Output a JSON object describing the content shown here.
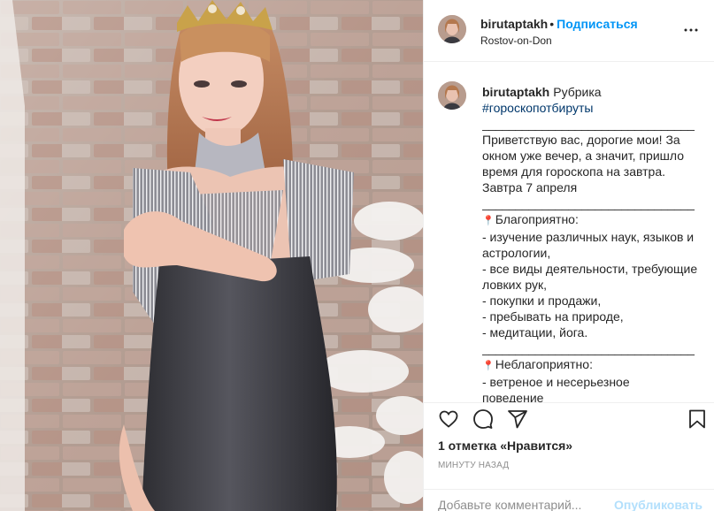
{
  "post": {
    "username": "birutaptakh",
    "separator": "•",
    "follow_label": "Подписаться",
    "location": "Rostov-on-Don"
  },
  "caption": {
    "username": "birutaptakh",
    "lead": "Рубрика",
    "hashtag": "#гороскопотбируты",
    "divider1": "________________________________",
    "greeting": [
      "Приветствую вас, дорогие мои! За",
      "окном уже вечер, а значит, пришло",
      "время для гороскопа на завтра.",
      "Завтра 7 апреля"
    ],
    "divider2": "________________________________",
    "favorable_title": "Благоприятно:",
    "favorable": [
      "- изучение различных наук, языков и",
      "астрологии,",
      "- все виды деятельности, требующие",
      "ловких рук,",
      "- покупки и продажи,",
      "- пребывать на природе,",
      "- медитации, йога."
    ],
    "divider3": "________________________________",
    "unfavorable_title": "Неблагоприятно:",
    "unfavorable": [
      "- ветреное и несерьезное",
      "поведение"
    ]
  },
  "actions": {
    "likes": "1 отметка «Нравится»",
    "time": "МИНУТУ НАЗАД"
  },
  "comment": {
    "placeholder": "Добавьте комментарий...",
    "post_label": "Опубликовать"
  },
  "icons": {
    "more": "more-options-icon",
    "like": "heart-icon",
    "comment": "comment-icon",
    "share": "share-icon",
    "save": "bookmark-icon",
    "pin": "pushpin-icon"
  },
  "colors": {
    "accent": "#0095f6",
    "hashtag": "#00376b",
    "post_disabled": "#b2dffc",
    "muted": "#8e8e8e"
  }
}
